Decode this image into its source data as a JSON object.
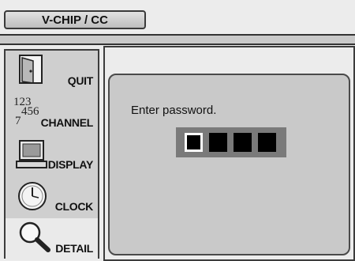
{
  "header": {
    "title": "V-CHIP / CC"
  },
  "sidebar": {
    "items": [
      {
        "label": "QUIT",
        "icon": "door-icon",
        "selected": false
      },
      {
        "label": "CHANNEL",
        "icon": "channel-numbers-icon",
        "selected": false
      },
      {
        "label": "DISPLAY",
        "icon": "monitor-icon",
        "selected": false
      },
      {
        "label": "CLOCK",
        "icon": "clock-icon",
        "selected": false
      },
      {
        "label": "DETAIL",
        "icon": "magnifier-icon",
        "selected": true
      }
    ],
    "channel_icon_digits": [
      "123",
      "456",
      "7"
    ]
  },
  "dialog": {
    "prompt": "Enter password.",
    "password_digits": 4,
    "active_digit": 1
  }
}
